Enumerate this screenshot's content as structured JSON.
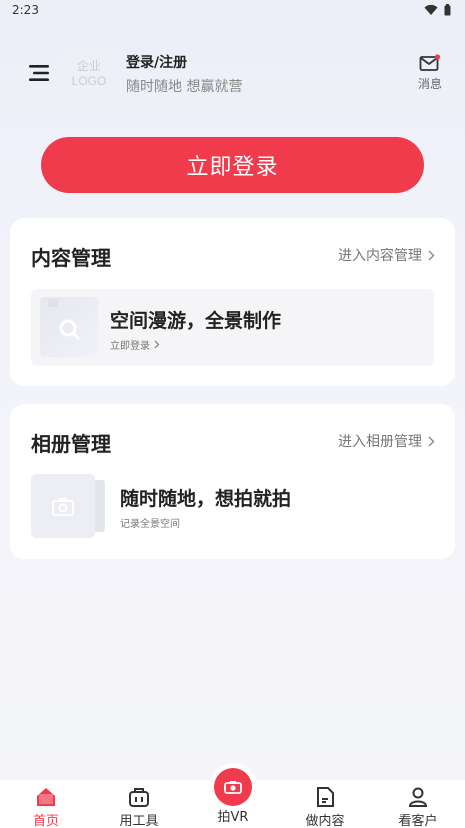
{
  "status_bar": {
    "time": "2:23"
  },
  "header": {
    "logo_line1": "企业",
    "logo_line2": "LOGO",
    "login_title": "登录/注册",
    "login_subtitle": "随时随地 想赢就营",
    "messages_label": "消息"
  },
  "login_button": {
    "label": "立即登录"
  },
  "content_card": {
    "title": "内容管理",
    "link": "进入内容管理",
    "item_title": "空间漫游，全景制作",
    "item_sub": "立即登录"
  },
  "album_card": {
    "title": "相册管理",
    "link": "进入相册管理",
    "item_title": "随时随地，想拍就拍",
    "item_sub": "记录全景空间"
  },
  "tabs": [
    {
      "label": "首页",
      "icon": "home-icon",
      "active": true
    },
    {
      "label": "用工具",
      "icon": "toolbox-icon",
      "active": false
    },
    {
      "label": "拍VR",
      "icon": "camera-icon",
      "active": false
    },
    {
      "label": "做内容",
      "icon": "document-icon",
      "active": false
    },
    {
      "label": "看客户",
      "icon": "person-icon",
      "active": false
    }
  ],
  "colors": {
    "accent": "#ef3b4c"
  }
}
